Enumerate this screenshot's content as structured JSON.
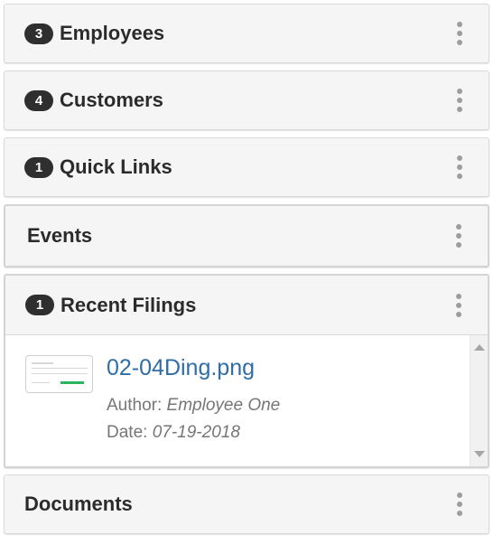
{
  "panels": {
    "employees": {
      "badge": "3",
      "title": "Employees"
    },
    "customers": {
      "badge": "4",
      "title": "Customers"
    },
    "quick_links": {
      "badge": "1",
      "title": "Quick Links"
    },
    "events": {
      "title": "Events"
    },
    "recent_filings": {
      "badge": "1",
      "title": "Recent Filings",
      "items": [
        {
          "file_name": "02-04Ding.png",
          "author_label": "Author:",
          "author": "Employee One",
          "date_label": "Date:",
          "date": "07-19-2018"
        }
      ]
    },
    "documents": {
      "title": "Documents"
    }
  },
  "colors": {
    "badge_bg": "#2f2f2f",
    "link": "#2f6da8",
    "panel_bg": "#f5f5f5",
    "kebab": "#9d9d9d"
  },
  "icons": {
    "panel_menu": "kebab-vertical-icon"
  }
}
